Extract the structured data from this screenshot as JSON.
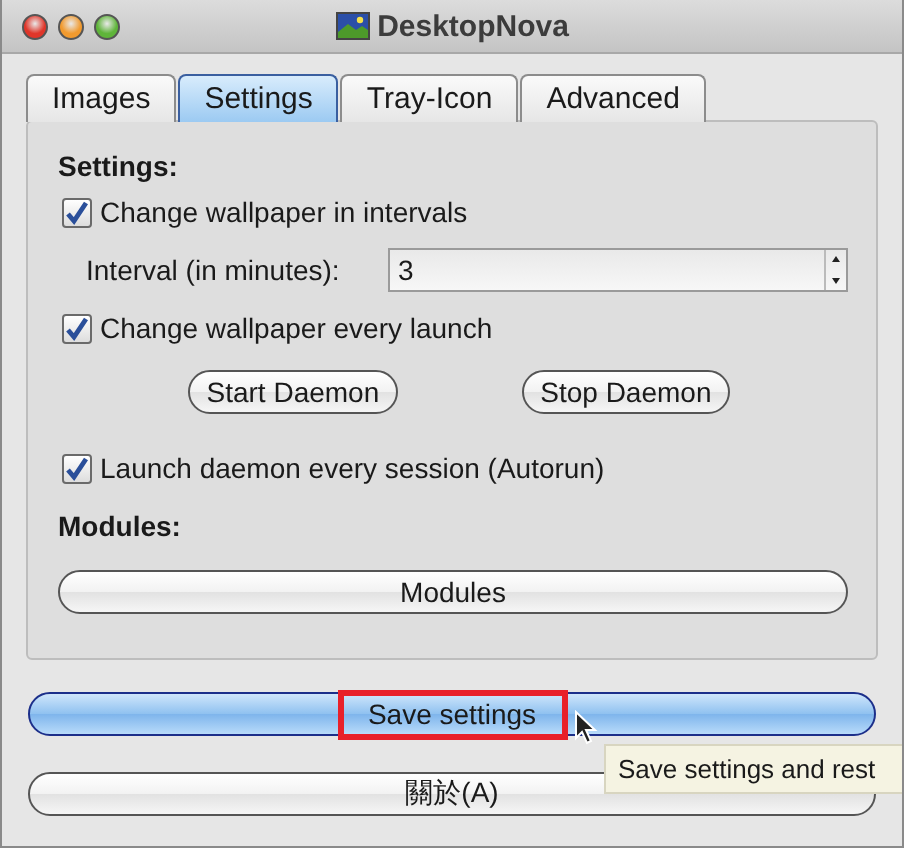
{
  "window": {
    "title": "DesktopNova"
  },
  "tabs": [
    {
      "label": "Images",
      "selected": false
    },
    {
      "label": "Settings",
      "selected": true
    },
    {
      "label": "Tray-Icon",
      "selected": false
    },
    {
      "label": "Advanced",
      "selected": false
    }
  ],
  "settings_heading": "Settings:",
  "change_in_intervals": {
    "label": "Change wallpaper in intervals",
    "checked": true
  },
  "interval": {
    "label": "Interval (in minutes):",
    "value": "3"
  },
  "change_every_launch": {
    "label": "Change wallpaper every launch",
    "checked": true
  },
  "daemon_buttons": [
    "Start Daemon",
    "Stop Daemon"
  ],
  "autorun": {
    "label": "Launch daemon every session (Autorun)",
    "checked": true
  },
  "modules_heading": "Modules:",
  "modules_button": "Modules",
  "save_button": {
    "label": "Save settings",
    "highlighted": true
  },
  "about_button": "關於(A)",
  "tooltip": "Save settings and rest"
}
